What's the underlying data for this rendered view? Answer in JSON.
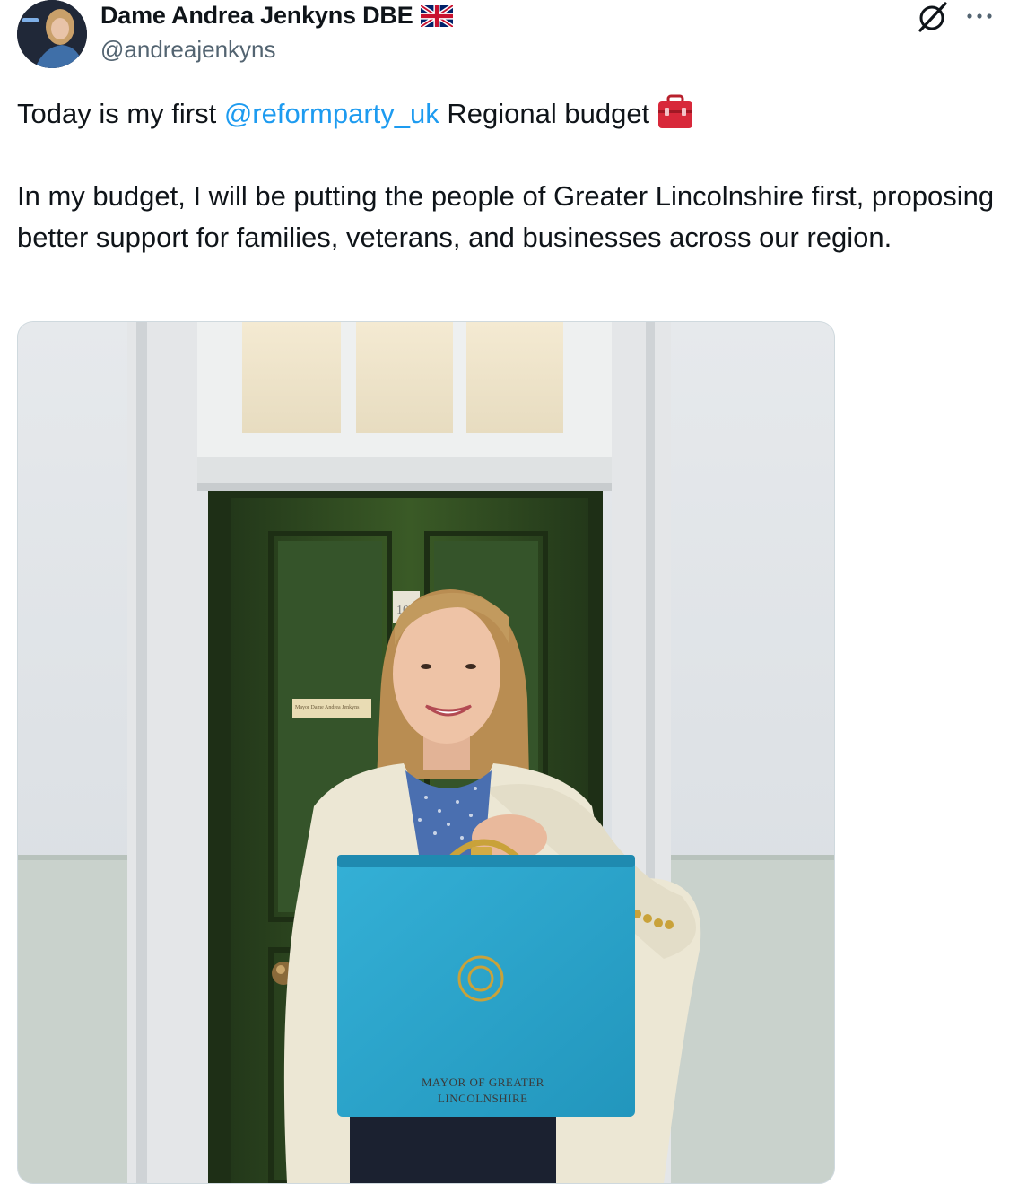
{
  "author": {
    "display_name": "Dame Andrea Jenkyns DBE",
    "handle": "@andreajenkyns",
    "flag_icon": "uk-flag-icon",
    "avatar": "avatar-photo"
  },
  "header_icons": {
    "grok": "grok-icon",
    "more": "more-options-icon"
  },
  "tweet": {
    "line1_prefix": "Today is my first ",
    "line1_mention": "@reformparty_uk",
    "line1_suffix": " Regional budget",
    "line1_emoji": "toolbox-icon",
    "body": "In my budget, I will be putting the people of Greater Lincolnshire first, proposing better support for families, veterans, and businesses across our region."
  },
  "photo": {
    "door_number": "10",
    "door_plaque": "Mayor Dame Andrea Jenkyns",
    "box_line1": "MAYOR OF GREATER",
    "box_line2": "LINCOLNSHIRE"
  },
  "colors": {
    "mention": "#1d9bf0",
    "secondary_text": "#536471",
    "box": "#2aa6cc",
    "door": "#2f4a1f"
  }
}
